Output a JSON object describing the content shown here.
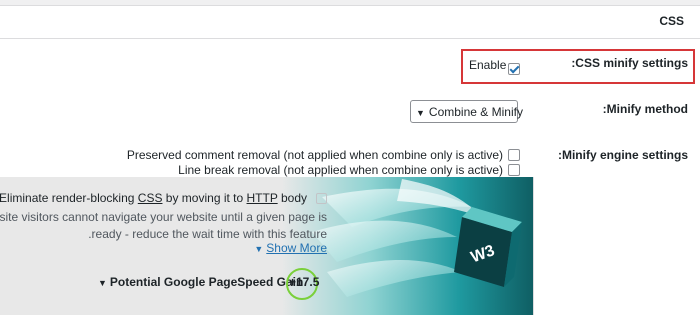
{
  "panel": {
    "title": "CSS"
  },
  "rows": {
    "minify_settings_label": ":CSS minify settings",
    "minify_method_label": ":Minify method",
    "engine_settings_label": ":Minify engine settings"
  },
  "minify": {
    "enable_label": "Enable",
    "enable_checked": true
  },
  "method": {
    "selected": "Combine & Minify"
  },
  "engine": {
    "options": [
      {
        "label": "Preserved comment removal (not applied when combine only is active)",
        "checked": false
      },
      {
        "label": "Line break removal (not applied when combine only is active)",
        "checked": false
      }
    ]
  },
  "promo": {
    "title_prefix": "Eliminate render-blocking ",
    "title_css": "CSS",
    "title_middle": " by moving it to ",
    "title_http": "HTTP",
    "title_suffix": " body",
    "desc_line1": "Website visitors cannot navigate your website until a given page is",
    "desc_line2": ".ready - reduce the wait time with this feature",
    "show_more": "Show More",
    "gain_label": "Potential Google PageSpeed Gain",
    "gain_value": "+17.5"
  },
  "colors": {
    "highlight": "#d63638",
    "accent": "#2271b1",
    "gain_ring": "#7ad03a",
    "art_teal": "#1f9aa0"
  }
}
